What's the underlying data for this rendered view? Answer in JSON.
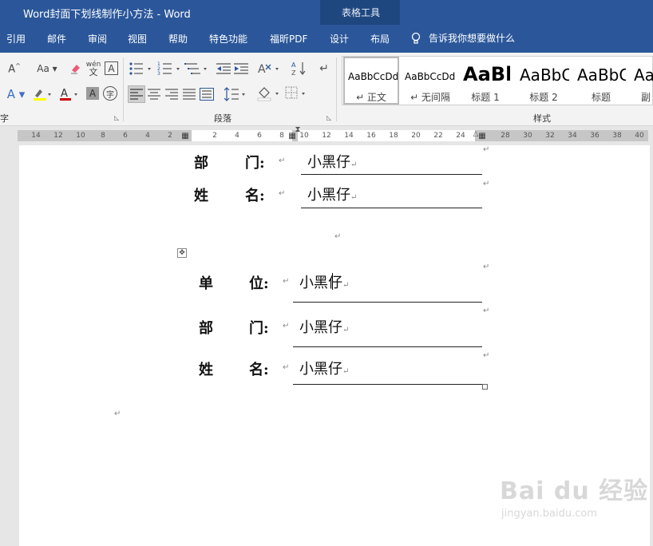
{
  "window": {
    "title": "Word封面下划线制作小方法  -  Word"
  },
  "context_tab_group": {
    "label": "表格工具"
  },
  "menu_tabs": [
    "引用",
    "邮件",
    "审阅",
    "视图",
    "帮助",
    "特色功能",
    "福昕PDF",
    "设计",
    "布局"
  ],
  "tell_me": {
    "text": "告诉我你想要做什么",
    "icon": "lightbulb-icon"
  },
  "ribbon": {
    "paragraph_group_label": "段落",
    "styles_group_label": "样式",
    "font_group_label_fragment": "字",
    "styles": [
      {
        "sample": "AaBbCcDd",
        "name": "↵ 正文"
      },
      {
        "sample": "AaBbCcDd",
        "name": "↵ 无间隔"
      },
      {
        "sample": "AaBl",
        "name": "标题 1"
      },
      {
        "sample": "AaBbC",
        "name": "标题 2"
      },
      {
        "sample": "AaBbC",
        "name": "标题"
      },
      {
        "sample": "Aa",
        "name": "副"
      }
    ]
  },
  "ruler": {
    "left_ticks": [
      "14",
      "12",
      "10",
      "8",
      "6",
      "4",
      "2"
    ],
    "mid_ticks": [
      "2",
      "4",
      "6",
      "8"
    ],
    "right_ticks": [
      "10",
      "12",
      "14",
      "16",
      "18",
      "20",
      "22",
      "24"
    ],
    "far_ticks": [
      "28",
      "30",
      "32",
      "34",
      "36",
      "38",
      "40"
    ]
  },
  "document": {
    "table1": [
      {
        "label_a": "部",
        "label_b": "门:",
        "value": "小黑仔"
      },
      {
        "label_a": "姓",
        "label_b": "名:",
        "value": "小黑仔"
      }
    ],
    "table2": [
      {
        "label_a": "单",
        "label_b": "位:",
        "value": "小黑仔"
      },
      {
        "label_a": "部",
        "label_b": "门:",
        "value": "小黑仔"
      },
      {
        "label_a": "姓",
        "label_b": "名:",
        "value": "小黑仔"
      }
    ],
    "paragraph_mark": "↵"
  },
  "watermark": {
    "text": "Bai du 经验",
    "subtext": "jingyan.baidu.com"
  },
  "colors": {
    "title_bar": "#2b579a",
    "context_group": "#1f477f",
    "ribbon_bg": "#f3f3f3"
  }
}
